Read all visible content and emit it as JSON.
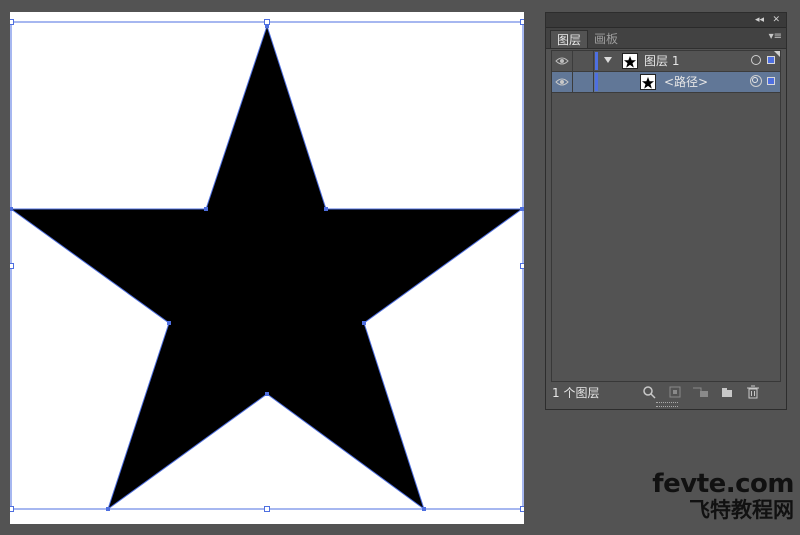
{
  "panel": {
    "tabs": [
      {
        "label": "图层",
        "active": true
      },
      {
        "label": "画板",
        "active": false
      }
    ],
    "collapse_glyph": "◂◂",
    "close_glyph": "✕",
    "menu_glyph": "▾≡",
    "layers": [
      {
        "name": "图层 1",
        "type": "layer",
        "expanded": true,
        "selected": false
      },
      {
        "name": "<路径>",
        "type": "path",
        "selected": true
      }
    ],
    "footer": {
      "count_label": "1 个图层",
      "icons": [
        "locate-object-icon",
        "make-clipping-mask-icon",
        "create-sublayer-icon",
        "create-new-layer-icon",
        "delete-icon"
      ]
    },
    "layer_color": "#4e6fe0",
    "selection_row_color": "#617797"
  },
  "canvas": {
    "shape": "five-point-star",
    "fill": "#000000",
    "selection_color": "#4e6fe0"
  },
  "watermark": {
    "line1": "fevte.com",
    "line2": "飞特教程网"
  }
}
